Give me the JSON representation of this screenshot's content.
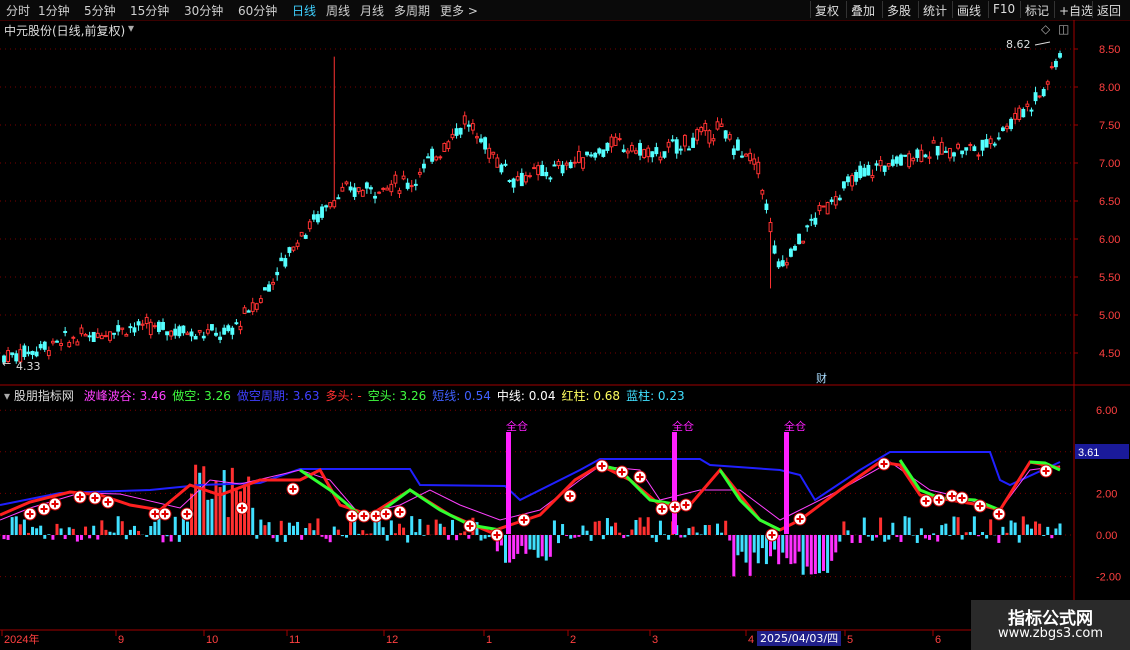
{
  "toolbar": {
    "periods": [
      "分时",
      "1分钟",
      "5分钟",
      "15分钟",
      "30分钟",
      "60分钟",
      "日线",
      "周线",
      "月线",
      "多周期",
      "更多 >"
    ],
    "active_period": "日线",
    "right_buttons": [
      "复权",
      "叠加",
      "多股",
      "统计",
      "画线",
      "F10",
      "标记",
      "+自选",
      "返回"
    ]
  },
  "main_chart": {
    "title": "中元股份(日线,前复权)",
    "high_label": "8.62",
    "low_label": "4.33",
    "fin_marker": "财",
    "y_ticks": [
      "8.50",
      "8.00",
      "7.50",
      "7.00",
      "6.50",
      "6.00",
      "5.50",
      "5.00",
      "4.50"
    ]
  },
  "indicator": {
    "name": "股朋指标网",
    "legend": [
      {
        "label": "波峰波谷:",
        "value": "3.46",
        "color": "#ff40ff"
      },
      {
        "label": "做空:",
        "value": "3.26",
        "color": "#40ff40"
      },
      {
        "label": "做空周期:",
        "value": "3.63",
        "color": "#4040ff"
      },
      {
        "label": "多头:",
        "value": "-",
        "color": "#ff3030"
      },
      {
        "label": "空头:",
        "value": "3.26",
        "color": "#40ff40"
      },
      {
        "label": "短线:",
        "value": "0.54",
        "color": "#4060ff"
      },
      {
        "label": "中线:",
        "value": "0.04",
        "color": "#ffffff"
      },
      {
        "label": "红柱:",
        "value": "0.68",
        "color": "#ffff60"
      },
      {
        "label": "蓝柱:",
        "value": "0.23",
        "color": "#40e0ff"
      }
    ],
    "y_ticks": [
      "6.00",
      "4.00",
      "2.00",
      "0.00",
      "-2.00"
    ],
    "current_value": "3.61",
    "signal_label": "全仓",
    "signal_count": 3
  },
  "x_axis": {
    "labels": [
      "2024年",
      "9",
      "10",
      "11",
      "12",
      "1",
      "2",
      "3",
      "4",
      "5",
      "6"
    ],
    "cursor_date": "2025/04/03/四"
  },
  "watermark": {
    "line1": "指标公式网",
    "line2": "www.zbgs3.com"
  },
  "colors": {
    "up": "#ff3232",
    "down": "#54ffff",
    "accent": "#3fd0ff",
    "grid": "#7a0000",
    "signal": "#ff20ff"
  }
}
